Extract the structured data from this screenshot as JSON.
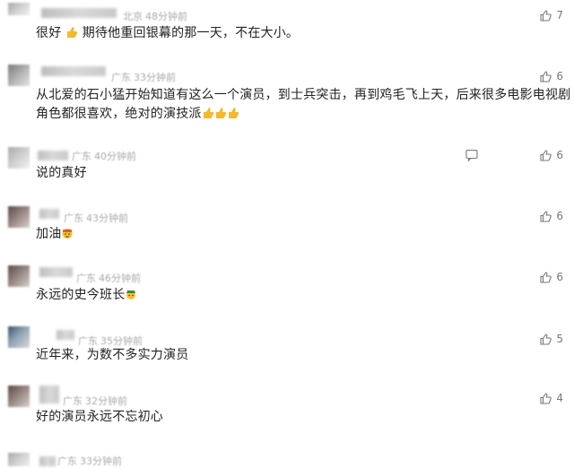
{
  "comments": [
    {
      "region": "北京",
      "time": "48分钟前",
      "text": "很好",
      "text2": "期待他重回银幕的那一天，不在大小。",
      "likes": "7"
    },
    {
      "region": "广东",
      "time": "33分钟前",
      "text": "从北爱的石小猛开始知道有这么一个演员，到士兵突击，再到鸡毛飞上天，后来很多电影电视剧",
      "text2": "角色都很喜欢，绝对的演技派",
      "likes": "6"
    },
    {
      "region": "广东",
      "time": "40分钟前",
      "text": "说的真好",
      "likes": "6"
    },
    {
      "region": "广东",
      "time": "43分钟前",
      "text": "加油",
      "likes": "6"
    },
    {
      "region": "广东",
      "time": "46分钟前",
      "text": "永远的史今班长",
      "likes": "6"
    },
    {
      "region": "广东",
      "time": "35分钟前",
      "text": "近年来，为数不多实力演员",
      "likes": "5"
    },
    {
      "region": "广东",
      "time": "32分钟前",
      "text": "好的演员永远不忘初心",
      "likes": "4"
    },
    {
      "region": "广东",
      "time": "33分钟前"
    }
  ],
  "colors": {
    "text": "#222222",
    "meta": "#a9a9a9",
    "like": "#777777"
  },
  "icons": {
    "like": "thumbs-up-icon",
    "reply": "speech-bubble-icon",
    "emoji_thumb": "thumbs-up-emoji",
    "emoji_cheer": "cheer-emoji",
    "emoji_salute": "salute-emoji"
  }
}
